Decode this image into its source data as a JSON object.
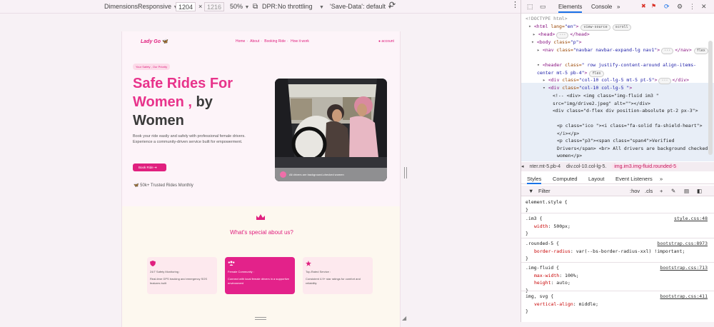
{
  "toolbar": {
    "dimensions_label": "Dimensions:",
    "dimensions_value": "Responsive",
    "width": "1204",
    "times": "×",
    "height": "1216",
    "zoom": "50%",
    "dpr_label": "DPR:",
    "throttling": "No throttling",
    "save_data": "'Save-Data': default"
  },
  "site": {
    "brand": "Lady Go",
    "nav": [
      "Home",
      "About",
      "Booking Ride",
      "How it work"
    ],
    "account": "account",
    "badge": "Your Safety , Our Priority",
    "title_part1": "Safe Rides For",
    "title_part2": "Women ,",
    "title_part3": "by",
    "title_part4": "Women",
    "subtitle": "Book your ride easily and safely with professional female drivers. Experience a community-driven service built for empowerment.",
    "cta": "Book Ride",
    "stat": "50k+ Trusted Rides Monthly",
    "image_caption": "All drivers are background-checked women",
    "special_title": "What's special about us?",
    "features": [
      {
        "title": "24/7 Safety Monitoring :",
        "text": "Real-time GPS tracking and emergency SOS features built"
      },
      {
        "title": "Female Community :",
        "text": "Connect with local female drivers in a supportive environment"
      },
      {
        "title": "Top-Rated Service :",
        "text": "Consistent 4.9+ star ratings for comfort and reliability"
      }
    ]
  },
  "devtools": {
    "tabs": [
      "Elements",
      "Console"
    ],
    "more": "»",
    "dom_lines": [
      {
        "html": "<!DOCTYPE html>"
      },
      {
        "open": "html",
        "attrs": [
          [
            "lang",
            "en"
          ]
        ],
        "pills": [
          "view-source",
          "scroll"
        ]
      },
      {
        "open": "head",
        "collapsed": "</head>"
      },
      {
        "open": "body",
        "attrs": [
          [
            "class",
            "p"
          ]
        ]
      },
      {
        "open": "nav",
        "attrs": [
          [
            "class",
            "navbar navbar-expand-lg nav1"
          ]
        ],
        "collapsed": "</nav>",
        "pills": [
          "flex"
        ]
      },
      {
        "open": "header",
        "attrs": [
          [
            "class",
            " row justify-content-around align-items-center mt-5 pb-4"
          ]
        ],
        "pills": [
          "flex"
        ]
      },
      {
        "open": "div",
        "attrs": [
          [
            "class",
            "col-10 col-lg-5 mt-5 pt-5"
          ]
        ],
        "collapsed": "</div>"
      },
      {
        "open": "div",
        "attrs": [
          [
            "class",
            "col-10 col-lg-5 "
          ]
        ]
      },
      {
        "comment": "<!-- <div> <img class=\"img-fluid im3 \" src=\"img/drive2.jpeg\" alt=\"\"></div>"
      },
      {
        "comment": "<div class=\"d-flex div  position-absolute pt-2 px-3\">"
      },
      {
        "comment": "<p class=\"ico \"><i class=\"fa-solid fa-shield-heart\"></i></p>"
      },
      {
        "comment": "<p class=\"p3\"><span class=\"span4\">Verified Drivers</span> <br> All drivers are background checked women</p>"
      }
    ],
    "breadcrumbs": [
      "nter.mt-5.pb-4",
      "div.col-10.col-lg-5.",
      "img.im3.img-fluid.rounded-5"
    ],
    "styles_tabs": [
      "Styles",
      "Computed",
      "Layout",
      "Event Listeners"
    ],
    "filter_placeholder": "Filter",
    "filter_tools": [
      ":hov",
      ".cls",
      "+"
    ],
    "rules": [
      {
        "selector": "element.style {",
        "src": "",
        "props": [],
        "close": "}"
      },
      {
        "selector": ".im3 {",
        "src": "style.css:48",
        "props": [
          [
            "width",
            "500px;"
          ]
        ],
        "close": "}"
      },
      {
        "selector": ".rounded-5 {",
        "src": "bootstrap.css:8973",
        "props": [
          [
            "border-radius",
            "var(--bs-border-radius-xxl) !important;"
          ]
        ],
        "close": "}"
      },
      {
        "selector": ".img-fluid {",
        "src": "bootstrap.css:713",
        "props": [
          [
            "max-width",
            "100%;"
          ],
          [
            "height",
            "auto;"
          ]
        ],
        "close": "}"
      },
      {
        "selector": "img, svg {",
        "src": "bootstrap.css:411",
        "props": [
          [
            "vertical-align",
            "middle;"
          ]
        ],
        "close": "}"
      }
    ]
  }
}
